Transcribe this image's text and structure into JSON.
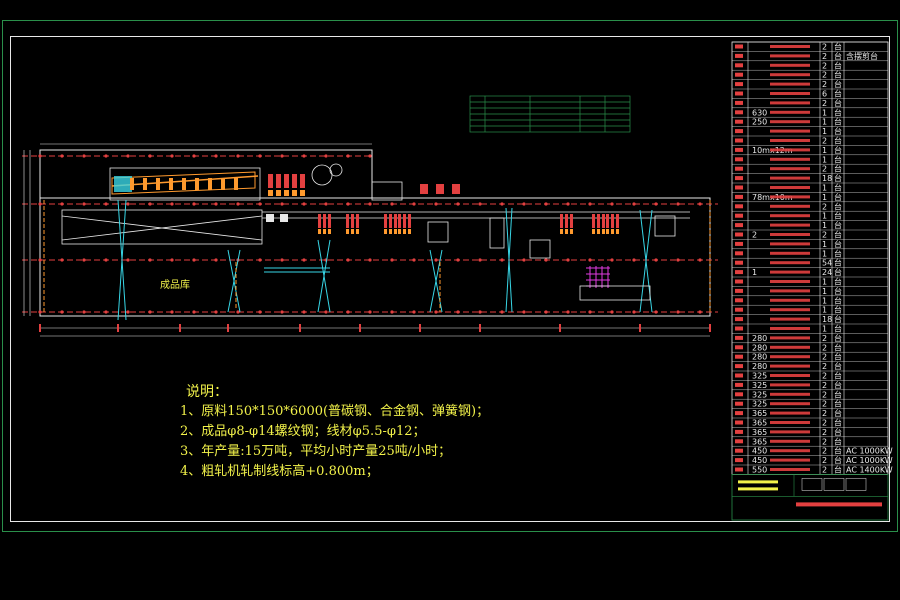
{
  "notes": {
    "title": "说明：",
    "lines": [
      "1、原料150*150*6000(普碳钢、合金钢、弹簧钢)；",
      "2、成品φ8-φ14螺纹钢；线材φ5.5-φ12；",
      "3、年产量:15万吨，平均小时产量25吨/小时；",
      "4、粗轧机轧制线标高+0.800m；"
    ]
  },
  "plan": {
    "finished_store_label": "成品库"
  },
  "equipment_table": {
    "rows": [
      {
        "name": "",
        "qty": "2",
        "unit": "台",
        "note": ""
      },
      {
        "name": "",
        "qty": "2",
        "unit": "台",
        "note": "含摆剪台"
      },
      {
        "name": "",
        "qty": "2",
        "unit": "台",
        "note": ""
      },
      {
        "name": "",
        "qty": "2",
        "unit": "台",
        "note": ""
      },
      {
        "name": "",
        "qty": "2",
        "unit": "台",
        "note": ""
      },
      {
        "name": "",
        "qty": "6",
        "unit": "台",
        "note": ""
      },
      {
        "name": "",
        "qty": "2",
        "unit": "台",
        "note": ""
      },
      {
        "name": "630",
        "qty": "1",
        "unit": "台",
        "note": ""
      },
      {
        "name": "250",
        "qty": "1",
        "unit": "台",
        "note": ""
      },
      {
        "name": "",
        "qty": "1",
        "unit": "台",
        "note": ""
      },
      {
        "name": "",
        "qty": "2",
        "unit": "台",
        "note": ""
      },
      {
        "name": "10mx12m",
        "qty": "1",
        "unit": "台",
        "note": ""
      },
      {
        "name": "",
        "qty": "1",
        "unit": "台",
        "note": ""
      },
      {
        "name": "",
        "qty": "2",
        "unit": "台",
        "note": ""
      },
      {
        "name": "",
        "qty": "18",
        "unit": "台",
        "note": ""
      },
      {
        "name": "",
        "qty": "1",
        "unit": "台",
        "note": ""
      },
      {
        "name": "78mx10m",
        "qty": "1",
        "unit": "台",
        "note": ""
      },
      {
        "name": "",
        "qty": "2",
        "unit": "台",
        "note": ""
      },
      {
        "name": "",
        "qty": "1",
        "unit": "台",
        "note": ""
      },
      {
        "name": "",
        "qty": "1",
        "unit": "台",
        "note": ""
      },
      {
        "name": "2",
        "qty": "2",
        "unit": "台",
        "note": ""
      },
      {
        "name": "",
        "qty": "1",
        "unit": "台",
        "note": ""
      },
      {
        "name": "",
        "qty": "1",
        "unit": "台",
        "note": ""
      },
      {
        "name": "",
        "qty": "54",
        "unit": "台",
        "note": ""
      },
      {
        "name": "1",
        "qty": "24",
        "unit": "台",
        "note": ""
      },
      {
        "name": "",
        "qty": "1",
        "unit": "台",
        "note": ""
      },
      {
        "name": "",
        "qty": "1",
        "unit": "台",
        "note": ""
      },
      {
        "name": "",
        "qty": "1",
        "unit": "台",
        "note": ""
      },
      {
        "name": "",
        "qty": "1",
        "unit": "台",
        "note": ""
      },
      {
        "name": "",
        "qty": "18",
        "unit": "台",
        "note": ""
      },
      {
        "name": "",
        "qty": "1",
        "unit": "台",
        "note": ""
      },
      {
        "name": "280",
        "qty": "2",
        "unit": "台",
        "note": ""
      },
      {
        "name": "280",
        "qty": "2",
        "unit": "台",
        "note": ""
      },
      {
        "name": "280",
        "qty": "2",
        "unit": "台",
        "note": ""
      },
      {
        "name": "280",
        "qty": "2",
        "unit": "台",
        "note": ""
      },
      {
        "name": "325",
        "qty": "2",
        "unit": "台",
        "note": ""
      },
      {
        "name": "325",
        "qty": "2",
        "unit": "台",
        "note": ""
      },
      {
        "name": "325",
        "qty": "2",
        "unit": "台",
        "note": ""
      },
      {
        "name": "325",
        "qty": "2",
        "unit": "台",
        "note": ""
      },
      {
        "name": "365",
        "qty": "2",
        "unit": "台",
        "note": ""
      },
      {
        "name": "365",
        "qty": "2",
        "unit": "台",
        "note": ""
      },
      {
        "name": "365",
        "qty": "2",
        "unit": "台",
        "note": ""
      },
      {
        "name": "365",
        "qty": "2",
        "unit": "台",
        "note": ""
      },
      {
        "name": "450",
        "qty": "2",
        "unit": "台",
        "note": "AC 1000KW"
      },
      {
        "name": "450",
        "qty": "2",
        "unit": "台",
        "note": "AC 1000KW"
      },
      {
        "name": "550",
        "qty": "2",
        "unit": "台",
        "note": "AC 1400KW"
      }
    ]
  },
  "colors": {
    "grid_red": "#e34040",
    "grid_blue": "#6e7cff",
    "cyan": "#38d6e6",
    "yellow": "#f2f24a",
    "white": "#e8e8e8",
    "green": "#2a8f4a",
    "magenta": "#e23be2",
    "orange": "#ff9a2e"
  }
}
